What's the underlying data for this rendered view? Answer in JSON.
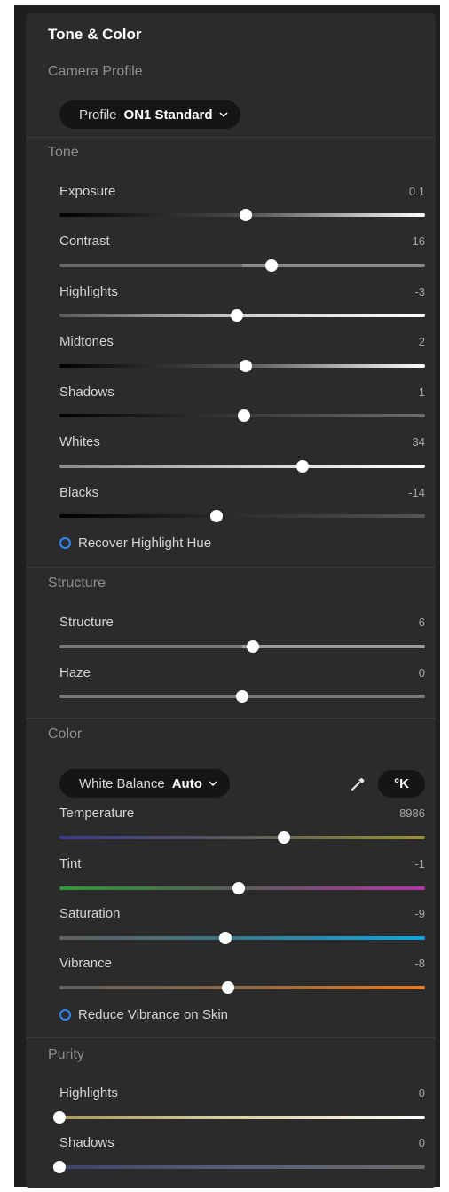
{
  "panel_title": "Tone & Color",
  "camera_profile": {
    "title": "Camera Profile",
    "label": "Profile",
    "value": "ON1 Standard"
  },
  "tone": {
    "title": "Tone",
    "sliders": [
      {
        "label": "Exposure",
        "value": "0.1",
        "pos": 0.51
      },
      {
        "label": "Contrast",
        "value": "16",
        "pos": 0.58
      },
      {
        "label": "Highlights",
        "value": "-3",
        "pos": 0.485
      },
      {
        "label": "Midtones",
        "value": "2",
        "pos": 0.51
      },
      {
        "label": "Shadows",
        "value": "1",
        "pos": 0.505
      },
      {
        "label": "Whites",
        "value": "34",
        "pos": 0.665
      },
      {
        "label": "Blacks",
        "value": "-14",
        "pos": 0.43
      }
    ],
    "checkbox": "Recover Highlight Hue"
  },
  "structure": {
    "title": "Structure",
    "sliders": [
      {
        "label": "Structure",
        "value": "6",
        "pos": 0.53
      },
      {
        "label": "Haze",
        "value": "0",
        "pos": 0.5
      }
    ]
  },
  "color": {
    "title": "Color",
    "wb_label": "White Balance",
    "wb_value": "Auto",
    "kelvin_button": "°K",
    "sliders": [
      {
        "label": "Temperature",
        "value": "8986",
        "pos": 0.615
      },
      {
        "label": "Tint",
        "value": "-1",
        "pos": 0.49
      },
      {
        "label": "Saturation",
        "value": "-9",
        "pos": 0.455
      },
      {
        "label": "Vibrance",
        "value": "-8",
        "pos": 0.46
      }
    ],
    "checkbox": "Reduce Vibrance on Skin"
  },
  "purity": {
    "title": "Purity",
    "sliders": [
      {
        "label": "Highlights",
        "value": "0",
        "pos": 0.0
      },
      {
        "label": "Shadows",
        "value": "0",
        "pos": 0.0
      }
    ]
  },
  "accent_color": "#2f87f1"
}
